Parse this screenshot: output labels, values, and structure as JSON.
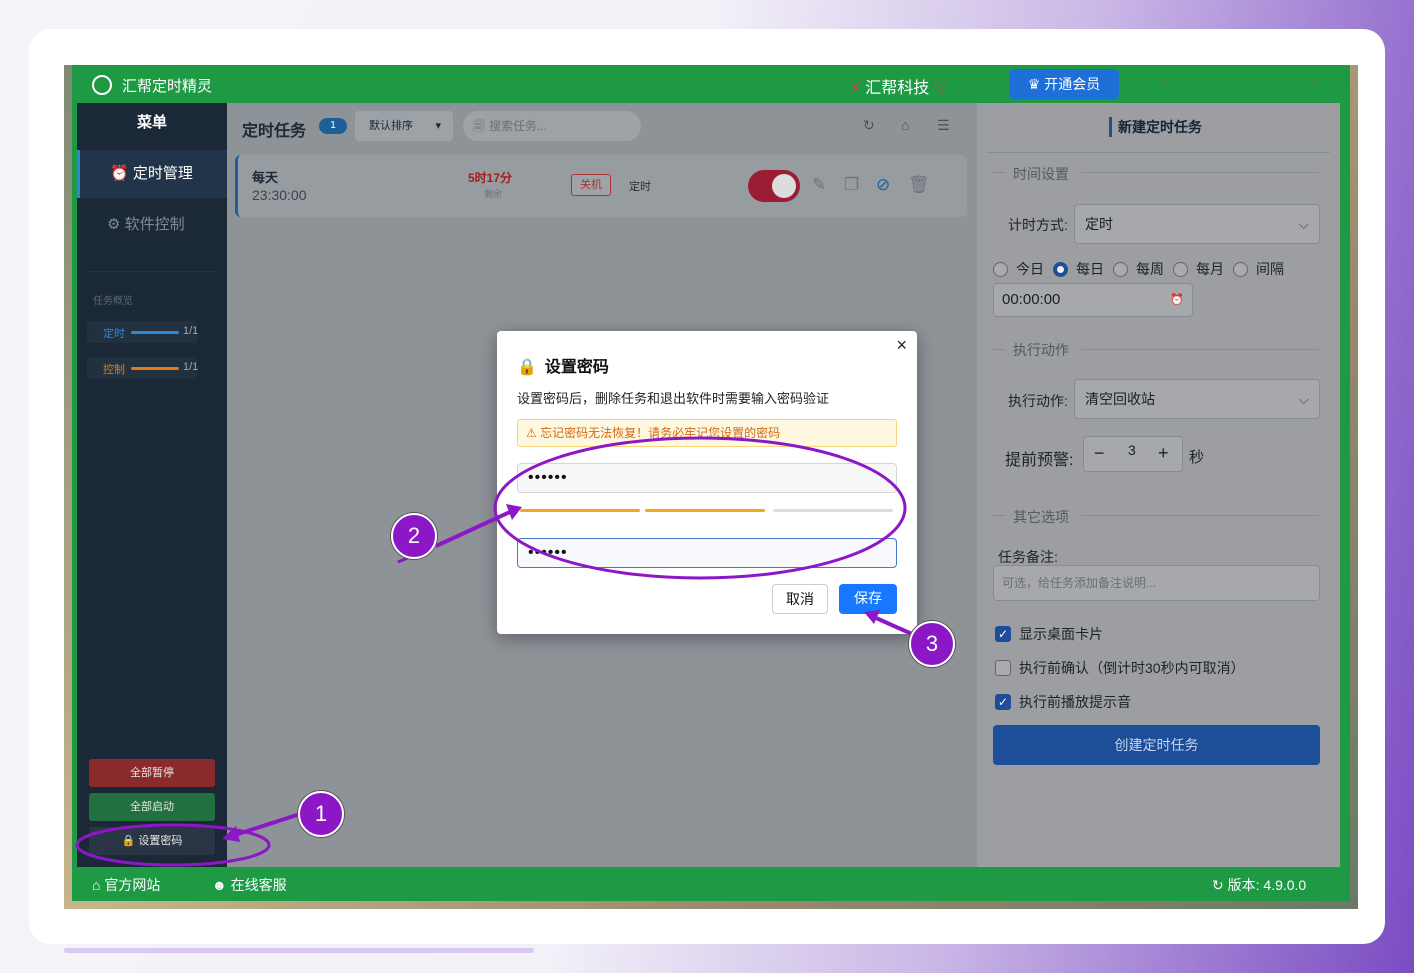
{
  "app": {
    "title": "汇帮定时精灵",
    "brand": "汇帮科技",
    "vip_button": "开通会员"
  },
  "sidebar": {
    "menu_header": "菜单",
    "items": [
      {
        "label": "定时管理",
        "icon": "alarm-clock-icon"
      },
      {
        "label": "软件控制",
        "icon": "gear-icon"
      }
    ],
    "overview_title": "任务概览",
    "overview": [
      {
        "label": "定时",
        "count": "1/1",
        "color": "#2f86d6"
      },
      {
        "label": "控制",
        "count": "1/1",
        "color": "#e07b1a"
      }
    ],
    "pause_all": "全部暂停",
    "start_all": "全部启动",
    "set_password": "设置密码"
  },
  "tasks": {
    "header": "定时任务",
    "count": "1",
    "sort": "默认排序",
    "search_placeholder": "搜索任务...",
    "items": [
      {
        "frequency": "每天",
        "time": "23:30:00",
        "remaining": "5时17分",
        "remaining_label": "剩余",
        "action_tag": "关机",
        "type": "定时",
        "enabled": true
      }
    ]
  },
  "form": {
    "header": "新建定时任务",
    "time_section": "时间设置",
    "timing_mode_label": "计时方式:",
    "timing_mode_value": "定时",
    "repeat_options": [
      "今日",
      "每日",
      "每周",
      "每月",
      "间隔"
    ],
    "repeat_selected": "每日",
    "time_value": "00:00:00",
    "action_section": "执行动作",
    "action_label": "执行动作:",
    "action_value": "清空回收站",
    "warning_label": "提前预警:",
    "warning_value": "3",
    "warning_unit": "秒",
    "other_section": "其它选项",
    "note_label": "任务备注:",
    "note_placeholder": "可选，给任务添加备注说明...",
    "checkboxes": [
      {
        "label": "显示桌面卡片",
        "checked": true
      },
      {
        "label": "执行前确认（倒计时30秒内可取消）",
        "checked": false
      },
      {
        "label": "执行前播放提示音",
        "checked": true
      }
    ],
    "create_button": "创建定时任务"
  },
  "footer": {
    "website": "官方网站",
    "support": "在线客服",
    "version": "版本: 4.9.0.0"
  },
  "dialog": {
    "title": "设置密码",
    "description": "设置密码后，删除任务和退出软件时需要输入密码验证",
    "warning": "忘记密码无法恢复！请务必牢记您设置的密码",
    "password": "••••••",
    "confirm_password": "••••••",
    "cancel": "取消",
    "save": "保存"
  },
  "annotations": [
    "1",
    "2",
    "3"
  ],
  "colors": {
    "titlebar": "#1e9a44",
    "accent": "#1c4e9a",
    "annotation": "#8b17c6",
    "strength": "#f5a623"
  }
}
